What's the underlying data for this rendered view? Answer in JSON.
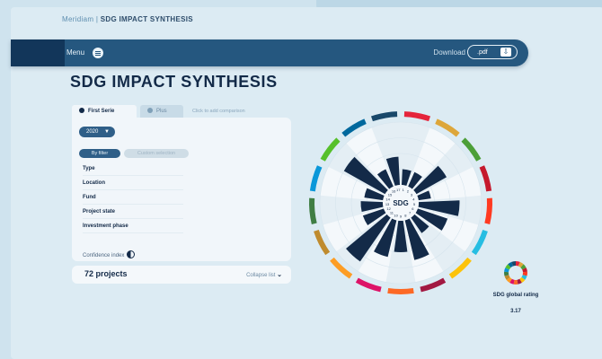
{
  "header": {
    "brand": "Meridiam",
    "separator": "|",
    "title": "SDG IMPACT SYNTHESIS"
  },
  "navbar": {
    "menu_label": "Menu",
    "download_label": "Download",
    "download_format": ".pdf"
  },
  "page": {
    "title": "SDG IMPACT SYNTHESIS"
  },
  "tabs": {
    "first": "First Serie",
    "plus": "Plus",
    "compare": "Click to add comparison"
  },
  "filters": {
    "year": "2020",
    "by_filter": "By filter",
    "custom_selection": "Custom selection",
    "fields": [
      "Type",
      "Location",
      "Fund",
      "Project state",
      "Investment phase"
    ],
    "confidence_index": "Confidence index"
  },
  "projects": {
    "count_label": "72 projects",
    "collapse_label": "Collapse list"
  },
  "chart_data": {
    "type": "radial_bar",
    "center_label": "SDG",
    "categories": [
      "SDG1",
      "SDG2",
      "SDG3",
      "SDG4",
      "SDG5",
      "SDG6",
      "SDG7",
      "SDG8",
      "SDG9",
      "SDG10",
      "SDG11",
      "SDG12",
      "SDG13",
      "SDG14",
      "SDG15",
      "SDG16",
      "SDG17"
    ],
    "values": [
      1.0,
      1.0,
      2.2,
      0.8,
      2.6,
      2.0,
      1.2,
      2.6,
      2.0,
      2.4,
      3.4,
      1.4,
      1.4,
      1.2,
      3.0,
      1.2,
      1.8
    ],
    "scale_max": 4,
    "ring_colors": [
      "#e5243b",
      "#dda63a",
      "#4c9f38",
      "#c5192d",
      "#ff3a21",
      "#26bde2",
      "#fcc30b",
      "#a21942",
      "#fd6925",
      "#dd1367",
      "#fd9d24",
      "#bf8b2e",
      "#3f7e44",
      "#0a97d9",
      "#56c02b",
      "#00689d",
      "#19486a"
    ]
  },
  "rating": {
    "label": "SDG global rating",
    "value": "3.17"
  },
  "colors": {
    "navy": "#132a48",
    "nav_bar": "#25577f",
    "background": "#dcebf3"
  }
}
